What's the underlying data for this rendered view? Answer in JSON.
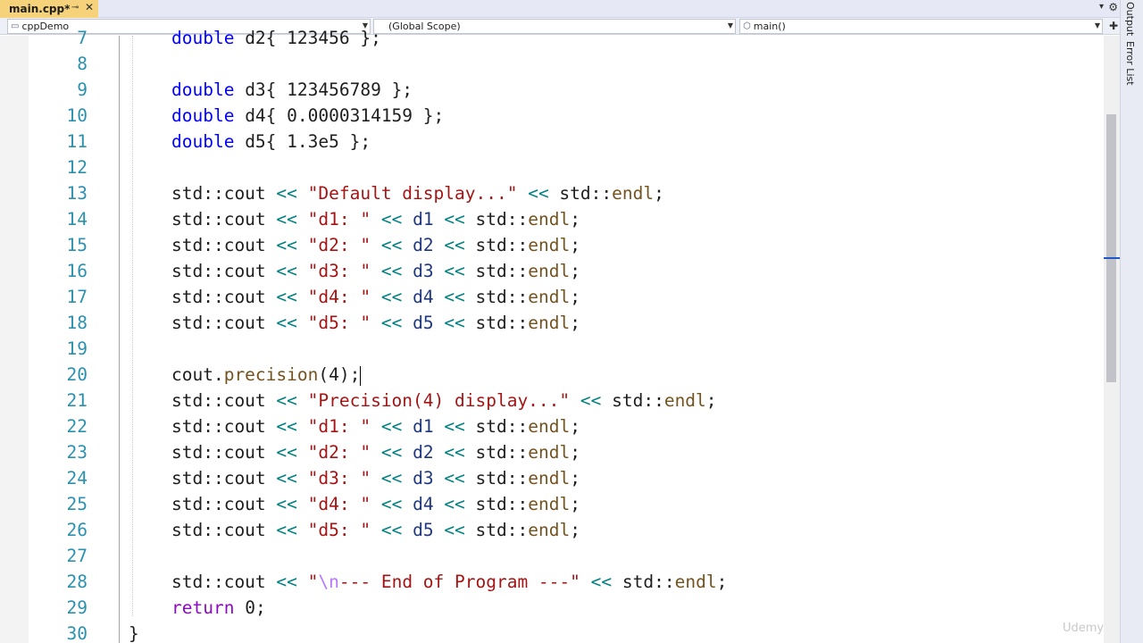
{
  "tab": {
    "title": "main.cpp*",
    "pin_icon": "pin-icon",
    "close_icon": "close-icon"
  },
  "navbar": {
    "project": "cppDemo",
    "scope": "(Global Scope)",
    "function": "main()"
  },
  "toolstrip": {
    "output_label": "Output",
    "errors_label": "Error List"
  },
  "editor": {
    "lines": [
      {
        "n": "7",
        "tokens": [
          [
            "kw",
            "double"
          ],
          [
            "ident",
            " d2{ "
          ],
          [
            "num",
            "123456"
          ],
          [
            "ident",
            " };"
          ]
        ]
      },
      {
        "n": "8",
        "tokens": []
      },
      {
        "n": "9",
        "tokens": [
          [
            "kw",
            "double"
          ],
          [
            "ident",
            " d3{ "
          ],
          [
            "num",
            "123456789"
          ],
          [
            "ident",
            " };"
          ]
        ]
      },
      {
        "n": "10",
        "tokens": [
          [
            "kw",
            "double"
          ],
          [
            "ident",
            " d4{ "
          ],
          [
            "num",
            "0.0000314159"
          ],
          [
            "ident",
            " };"
          ]
        ]
      },
      {
        "n": "11",
        "tokens": [
          [
            "kw",
            "double"
          ],
          [
            "ident",
            " d5{ "
          ],
          [
            "num",
            "1.3e5"
          ],
          [
            "ident",
            " };"
          ]
        ]
      },
      {
        "n": "12",
        "tokens": []
      },
      {
        "n": "13",
        "tokens": [
          [
            "ident",
            "std::cout "
          ],
          [
            "op",
            "<<"
          ],
          [
            "ident",
            " "
          ],
          [
            "str",
            "\"Default display...\""
          ],
          [
            "ident",
            " "
          ],
          [
            "op",
            "<<"
          ],
          [
            "ident",
            " std::"
          ],
          [
            "fn",
            "endl"
          ],
          [
            "ident",
            ";"
          ]
        ]
      },
      {
        "n": "14",
        "tokens": [
          [
            "ident",
            "std::cout "
          ],
          [
            "op",
            "<<"
          ],
          [
            "ident",
            " "
          ],
          [
            "str",
            "\"d1: \""
          ],
          [
            "ident",
            " "
          ],
          [
            "op",
            "<<"
          ],
          [
            "ident",
            " "
          ],
          [
            "var",
            "d1"
          ],
          [
            "ident",
            " "
          ],
          [
            "op",
            "<<"
          ],
          [
            "ident",
            " std::"
          ],
          [
            "fn",
            "endl"
          ],
          [
            "ident",
            ";"
          ]
        ]
      },
      {
        "n": "15",
        "tokens": [
          [
            "ident",
            "std::cout "
          ],
          [
            "op",
            "<<"
          ],
          [
            "ident",
            " "
          ],
          [
            "str",
            "\"d2: \""
          ],
          [
            "ident",
            " "
          ],
          [
            "op",
            "<<"
          ],
          [
            "ident",
            " "
          ],
          [
            "var",
            "d2"
          ],
          [
            "ident",
            " "
          ],
          [
            "op",
            "<<"
          ],
          [
            "ident",
            " std::"
          ],
          [
            "fn",
            "endl"
          ],
          [
            "ident",
            ";"
          ]
        ]
      },
      {
        "n": "16",
        "tokens": [
          [
            "ident",
            "std::cout "
          ],
          [
            "op",
            "<<"
          ],
          [
            "ident",
            " "
          ],
          [
            "str",
            "\"d3: \""
          ],
          [
            "ident",
            " "
          ],
          [
            "op",
            "<<"
          ],
          [
            "ident",
            " "
          ],
          [
            "var",
            "d3"
          ],
          [
            "ident",
            " "
          ],
          [
            "op",
            "<<"
          ],
          [
            "ident",
            " std::"
          ],
          [
            "fn",
            "endl"
          ],
          [
            "ident",
            ";"
          ]
        ]
      },
      {
        "n": "17",
        "tokens": [
          [
            "ident",
            "std::cout "
          ],
          [
            "op",
            "<<"
          ],
          [
            "ident",
            " "
          ],
          [
            "str",
            "\"d4: \""
          ],
          [
            "ident",
            " "
          ],
          [
            "op",
            "<<"
          ],
          [
            "ident",
            " "
          ],
          [
            "var",
            "d4"
          ],
          [
            "ident",
            " "
          ],
          [
            "op",
            "<<"
          ],
          [
            "ident",
            " std::"
          ],
          [
            "fn",
            "endl"
          ],
          [
            "ident",
            ";"
          ]
        ]
      },
      {
        "n": "18",
        "tokens": [
          [
            "ident",
            "std::cout "
          ],
          [
            "op",
            "<<"
          ],
          [
            "ident",
            " "
          ],
          [
            "str",
            "\"d5: \""
          ],
          [
            "ident",
            " "
          ],
          [
            "op",
            "<<"
          ],
          [
            "ident",
            " "
          ],
          [
            "var",
            "d5"
          ],
          [
            "ident",
            " "
          ],
          [
            "op",
            "<<"
          ],
          [
            "ident",
            " std::"
          ],
          [
            "fn",
            "endl"
          ],
          [
            "ident",
            ";"
          ]
        ]
      },
      {
        "n": "19",
        "tokens": []
      },
      {
        "n": "20",
        "tokens": [
          [
            "ident",
            "cout."
          ],
          [
            "fn",
            "precision"
          ],
          [
            "ident",
            "("
          ],
          [
            "num",
            "4"
          ],
          [
            "ident",
            ");"
          ]
        ],
        "caret": true
      },
      {
        "n": "21",
        "tokens": [
          [
            "ident",
            "std::cout "
          ],
          [
            "op",
            "<<"
          ],
          [
            "ident",
            " "
          ],
          [
            "str",
            "\"Precision(4) display...\""
          ],
          [
            "ident",
            " "
          ],
          [
            "op",
            "<<"
          ],
          [
            "ident",
            " std::"
          ],
          [
            "fn",
            "endl"
          ],
          [
            "ident",
            ";"
          ]
        ]
      },
      {
        "n": "22",
        "tokens": [
          [
            "ident",
            "std::cout "
          ],
          [
            "op",
            "<<"
          ],
          [
            "ident",
            " "
          ],
          [
            "str",
            "\"d1: \""
          ],
          [
            "ident",
            " "
          ],
          [
            "op",
            "<<"
          ],
          [
            "ident",
            " "
          ],
          [
            "var",
            "d1"
          ],
          [
            "ident",
            " "
          ],
          [
            "op",
            "<<"
          ],
          [
            "ident",
            " std::"
          ],
          [
            "fn",
            "endl"
          ],
          [
            "ident",
            ";"
          ]
        ]
      },
      {
        "n": "23",
        "tokens": [
          [
            "ident",
            "std::cout "
          ],
          [
            "op",
            "<<"
          ],
          [
            "ident",
            " "
          ],
          [
            "str",
            "\"d2: \""
          ],
          [
            "ident",
            " "
          ],
          [
            "op",
            "<<"
          ],
          [
            "ident",
            " "
          ],
          [
            "var",
            "d2"
          ],
          [
            "ident",
            " "
          ],
          [
            "op",
            "<<"
          ],
          [
            "ident",
            " std::"
          ],
          [
            "fn",
            "endl"
          ],
          [
            "ident",
            ";"
          ]
        ]
      },
      {
        "n": "24",
        "tokens": [
          [
            "ident",
            "std::cout "
          ],
          [
            "op",
            "<<"
          ],
          [
            "ident",
            " "
          ],
          [
            "str",
            "\"d3: \""
          ],
          [
            "ident",
            " "
          ],
          [
            "op",
            "<<"
          ],
          [
            "ident",
            " "
          ],
          [
            "var",
            "d3"
          ],
          [
            "ident",
            " "
          ],
          [
            "op",
            "<<"
          ],
          [
            "ident",
            " std::"
          ],
          [
            "fn",
            "endl"
          ],
          [
            "ident",
            ";"
          ]
        ]
      },
      {
        "n": "25",
        "tokens": [
          [
            "ident",
            "std::cout "
          ],
          [
            "op",
            "<<"
          ],
          [
            "ident",
            " "
          ],
          [
            "str",
            "\"d4: \""
          ],
          [
            "ident",
            " "
          ],
          [
            "op",
            "<<"
          ],
          [
            "ident",
            " "
          ],
          [
            "var",
            "d4"
          ],
          [
            "ident",
            " "
          ],
          [
            "op",
            "<<"
          ],
          [
            "ident",
            " std::"
          ],
          [
            "fn",
            "endl"
          ],
          [
            "ident",
            ";"
          ]
        ]
      },
      {
        "n": "26",
        "tokens": [
          [
            "ident",
            "std::cout "
          ],
          [
            "op",
            "<<"
          ],
          [
            "ident",
            " "
          ],
          [
            "str",
            "\"d5: \""
          ],
          [
            "ident",
            " "
          ],
          [
            "op",
            "<<"
          ],
          [
            "ident",
            " "
          ],
          [
            "var",
            "d5"
          ],
          [
            "ident",
            " "
          ],
          [
            "op",
            "<<"
          ],
          [
            "ident",
            " std::"
          ],
          [
            "fn",
            "endl"
          ],
          [
            "ident",
            ";"
          ]
        ]
      },
      {
        "n": "27",
        "tokens": []
      },
      {
        "n": "28",
        "tokens": [
          [
            "ident",
            "std::cout "
          ],
          [
            "op",
            "<<"
          ],
          [
            "ident",
            " "
          ],
          [
            "str",
            "\""
          ],
          [
            "esc",
            "\\n"
          ],
          [
            "str",
            "--- End of Program ---\""
          ],
          [
            "ident",
            " "
          ],
          [
            "op",
            "<<"
          ],
          [
            "ident",
            " std::"
          ],
          [
            "fn",
            "endl"
          ],
          [
            "ident",
            ";"
          ]
        ]
      },
      {
        "n": "29",
        "tokens": [
          [
            "kw2",
            "return"
          ],
          [
            "ident",
            " "
          ],
          [
            "num",
            "0"
          ],
          [
            "ident",
            ";"
          ]
        ]
      },
      {
        "n": "30",
        "tokens": [
          [
            "ident",
            "}"
          ]
        ],
        "outdent": true
      }
    ]
  },
  "watermark": "Udemy"
}
